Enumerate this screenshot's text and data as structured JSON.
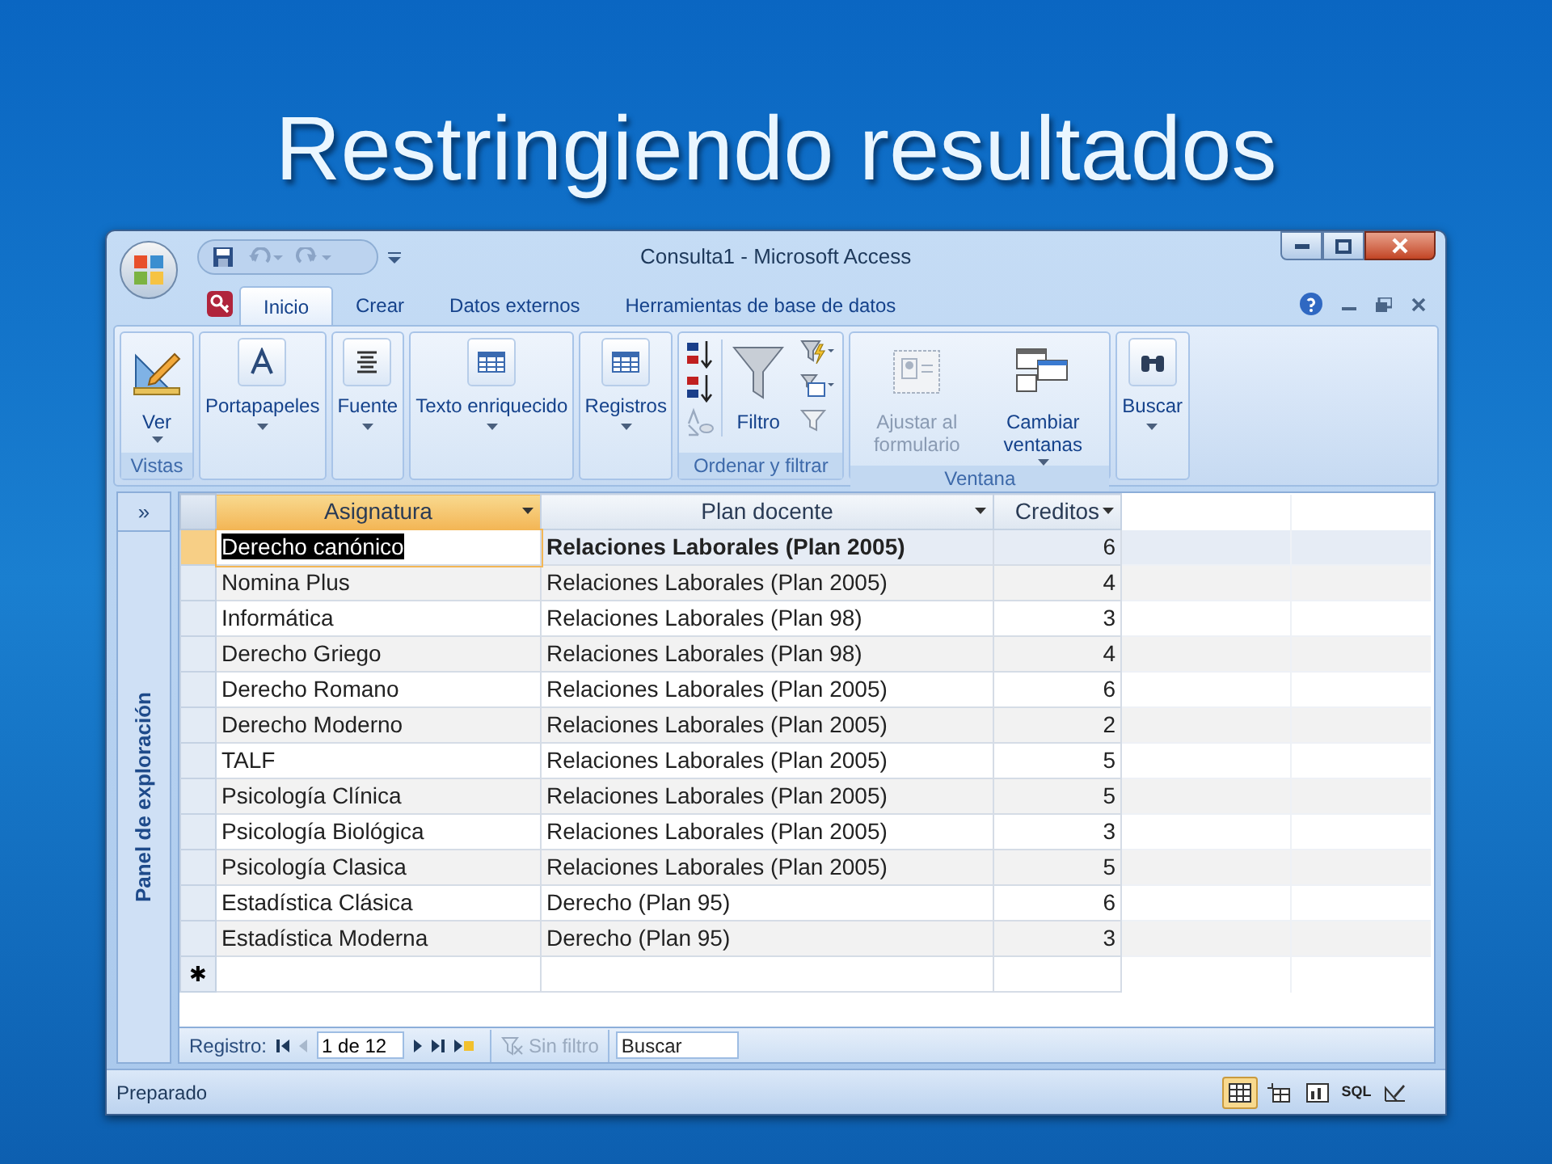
{
  "slide_title": "Restringiendo resultados",
  "window": {
    "title": "Consulta1 - Microsoft Access"
  },
  "tabs": [
    {
      "label": "Inicio",
      "selected": true
    },
    {
      "label": "Crear",
      "selected": false
    },
    {
      "label": "Datos externos",
      "selected": false
    },
    {
      "label": "Herramientas de base de datos",
      "selected": false
    }
  ],
  "ribbon": [
    {
      "kind": "group",
      "label": "Vistas",
      "buttons": [
        {
          "label": "Ver",
          "disabled": false
        }
      ]
    },
    {
      "kind": "collapsed",
      "label": "Portapapeles"
    },
    {
      "kind": "collapsed",
      "label": "Fuente"
    },
    {
      "kind": "collapsed",
      "label": "Texto enriquecido"
    },
    {
      "kind": "collapsed",
      "label": "Registros"
    },
    {
      "kind": "sortfilter",
      "label": "Ordenar y filtrar",
      "buttons": [
        {
          "label": "Filtro",
          "disabled": false
        }
      ]
    },
    {
      "kind": "group",
      "label": "Ventana",
      "buttons": [
        {
          "label": "Ajustar al formulario",
          "disabled": true
        },
        {
          "label": "Cambiar ventanas",
          "disabled": false
        }
      ]
    },
    {
      "kind": "collapsed",
      "label": "Buscar"
    }
  ],
  "nav_pane": {
    "toggle": "»",
    "title": "Panel de exploración"
  },
  "table": {
    "columns": [
      {
        "label": "Asignatura",
        "selected": true
      },
      {
        "label": "Plan docente",
        "selected": false
      },
      {
        "label": "Creditos",
        "selected": false
      }
    ],
    "rows": [
      {
        "selected": true,
        "cells": [
          "Derecho canónico",
          "Relaciones Laborales (Plan 2005)",
          "6"
        ]
      },
      {
        "selected": false,
        "cells": [
          "Nomina Plus",
          "Relaciones Laborales (Plan 2005)",
          "4"
        ]
      },
      {
        "selected": false,
        "cells": [
          "Informática",
          "Relaciones Laborales (Plan 98)",
          "3"
        ]
      },
      {
        "selected": false,
        "cells": [
          "Derecho Griego",
          "Relaciones Laborales (Plan 98)",
          "4"
        ]
      },
      {
        "selected": false,
        "cells": [
          "Derecho Romano",
          "Relaciones Laborales (Plan 2005)",
          "6"
        ]
      },
      {
        "selected": false,
        "cells": [
          "Derecho Moderno",
          "Relaciones Laborales (Plan 2005)",
          "2"
        ]
      },
      {
        "selected": false,
        "cells": [
          "TALF",
          "Relaciones Laborales (Plan 2005)",
          "5"
        ]
      },
      {
        "selected": false,
        "cells": [
          "Psicología Clínica",
          "Relaciones Laborales (Plan 2005)",
          "5"
        ]
      },
      {
        "selected": false,
        "cells": [
          "Psicología Biológica",
          "Relaciones Laborales (Plan 2005)",
          "3"
        ]
      },
      {
        "selected": false,
        "cells": [
          "Psicología Clasica",
          "Relaciones Laborales (Plan 2005)",
          "5"
        ]
      },
      {
        "selected": false,
        "cells": [
          "Estadística Clásica",
          "Derecho (Plan 95)",
          "6"
        ]
      },
      {
        "selected": false,
        "cells": [
          "Estadística Moderna",
          "Derecho (Plan 95)",
          "3"
        ]
      }
    ],
    "new_row_marker": "✱"
  },
  "record_nav": {
    "label": "Registro:",
    "position": "1 de 12",
    "filter": "Sin filtro",
    "filter_disabled": true,
    "search_placeholder": "Buscar"
  },
  "status_bar": {
    "text": "Preparado",
    "views": [
      {
        "selected": true
      },
      {
        "selected": false
      },
      {
        "selected": false
      },
      {
        "selected": false,
        "label": "SQL"
      },
      {
        "selected": false
      }
    ]
  }
}
